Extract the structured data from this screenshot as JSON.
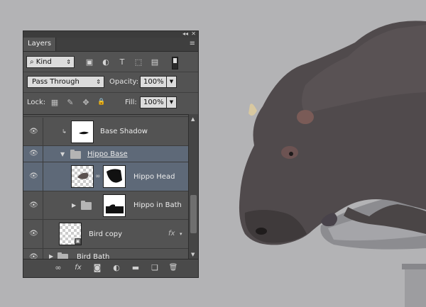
{
  "panel": {
    "collapse_glyph": "◂◂",
    "close_glyph": "✕",
    "tab_label": "Layers",
    "menu_glyph": "≡",
    "filter_kind": "Kind",
    "filter_search_glyph": "⌕",
    "filter_arrows": "⇕",
    "filter_icons": [
      {
        "name": "pixel-filter-icon",
        "glyph": "▣"
      },
      {
        "name": "adjustment-filter-icon",
        "glyph": "◐"
      },
      {
        "name": "type-filter-icon",
        "glyph": "T"
      },
      {
        "name": "shape-filter-icon",
        "glyph": "⬚"
      },
      {
        "name": "smartobject-filter-icon",
        "glyph": "▤"
      }
    ],
    "blend_mode": "Pass Through",
    "blend_arrows": "⇕",
    "opacity_label": "Opacity:",
    "opacity_value": "100%",
    "dropdown_glyph": "▼",
    "lock_label": "Lock:",
    "lock_icons": [
      {
        "name": "lock-transparent-icon",
        "glyph": "▦"
      },
      {
        "name": "lock-brush-icon",
        "glyph": "✎"
      },
      {
        "name": "lock-move-icon",
        "glyph": "✥"
      },
      {
        "name": "lock-all-icon",
        "glyph": "🔒"
      }
    ],
    "fill_label": "Fill:",
    "fill_value": "100%"
  },
  "layers": [
    {
      "name": "Base Shadow",
      "selected": false,
      "clipped": true,
      "clip_glyph": "↳"
    },
    {
      "name": "Hippo Base",
      "selected": true,
      "type": "group",
      "expanded": true
    },
    {
      "name": "Hippo Head",
      "selected": true,
      "link_glyph": "∞"
    },
    {
      "name": "Hippo in Bath",
      "selected": false,
      "type": "group",
      "expanded": false
    },
    {
      "name": "Bird copy",
      "selected": false,
      "fx": "fx",
      "smart_glyph": "▣"
    },
    {
      "name": "Bird Bath",
      "selected": false,
      "type": "group",
      "expanded": false
    }
  ],
  "eye_glyph": "👁",
  "tri_open": "▼",
  "tri_closed": "▶",
  "scroll": {
    "up": "▲",
    "down": "▼"
  },
  "footer_icons": [
    {
      "name": "link-layers-icon",
      "glyph": "∞"
    },
    {
      "name": "fx-icon",
      "glyph": "fx"
    },
    {
      "name": "add-mask-icon",
      "glyph": "◙"
    },
    {
      "name": "adjustment-layer-icon",
      "glyph": "◐"
    },
    {
      "name": "new-group-icon",
      "glyph": "▬"
    },
    {
      "name": "new-layer-icon",
      "glyph": "❏"
    },
    {
      "name": "delete-layer-icon",
      "glyph": "🗑"
    }
  ],
  "colors": {
    "selected_row": "#5e6978",
    "panel_bg": "#535353",
    "canvas_bg": "#b3b3b5"
  }
}
